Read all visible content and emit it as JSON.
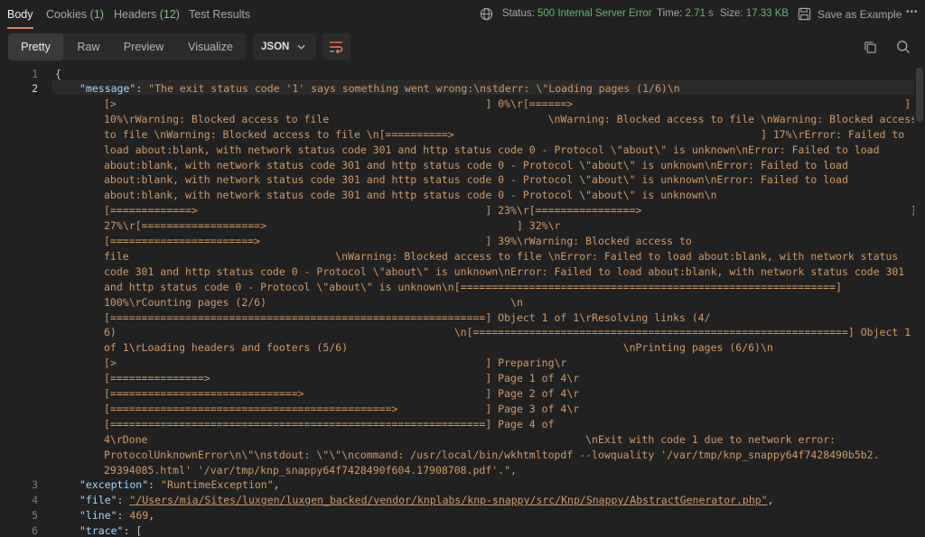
{
  "tabs": {
    "body": "Body",
    "cookies": "Cookies",
    "cookies_count": "(1)",
    "headers": "Headers",
    "headers_count": "(12)",
    "test_results": "Test Results"
  },
  "status": {
    "status_label": "Status:",
    "status_value": "500 Internal Server Error",
    "time_label": "Time:",
    "time_value": "2.71 s",
    "size_label": "Size:",
    "size_value": "17.33 KB",
    "save_label": "Save as Example",
    "more": "•••"
  },
  "toolbar": {
    "pretty": "Pretty",
    "raw": "Raw",
    "preview": "Preview",
    "visualize": "Visualize",
    "format": "JSON"
  },
  "colors": {
    "accent": "#f47c3c",
    "status_ok_text": "#5fb86a",
    "json_key": "#9cdcfe",
    "json_string": "#d19a66"
  },
  "code": {
    "line_numbers": [
      "1",
      "2",
      "3",
      "4",
      "5",
      "6"
    ],
    "l1": "{",
    "l2_key": "\"message\"",
    "l2_colon": ": ",
    "m": [
      "\"The exit status code '1' says something went wrong:\\nstderr: \\\"Loading pages (1/6)\\n",
      "[>                                                           ] 0%\\r[======>                                                     ]",
      "10%\\rWarning: Blocked access to file                                   \\nWarning: Blocked access to file \\nWarning: Blocked access",
      "to file \\nWarning: Blocked access to file \\n[==========>                                                 ] 17%\\rError: Failed to",
      "load about:blank, with network status code 301 and http status code 0 - Protocol \\\"about\\\" is unknown\\nError: Failed to load",
      "about:blank, with network status code 301 and http status code 0 - Protocol \\\"about\\\" is unknown\\nError: Failed to load",
      "about:blank, with network status code 301 and http status code 0 - Protocol \\\"about\\\" is unknown\\nError: Failed to load",
      "about:blank, with network status code 301 and http status code 0 - Protocol \\\"about\\\" is unknown\\n",
      "[=============>                                              ] 23%\\r[================>                                           ]",
      "27%\\r[===================>                                        ] 32%\\r",
      "[=======================>                                    ] 39%\\rWarning: Blocked access to",
      "file                                 \\nWarning: Blocked access to file \\nError: Failed to load about:blank, with network status",
      "code 301 and http status code 0 - Protocol \\\"about\\\" is unknown\\nError: Failed to load about:blank, with network status code 301",
      "and http status code 0 - Protocol \\\"about\\\" is unknown\\n[============================================================]",
      "100%\\rCounting pages (2/6)                                       \\n",
      "[============================================================] Object 1 of 1\\rResolving links (4/",
      "6)                                                      \\n[============================================================] Object 1",
      "of 1\\rLoading headers and footers (5/6)                                            \\nPrinting pages (6/6)\\n",
      "[>                                                           ] Preparing\\r",
      "[===============>                                            ] Page 1 of 4\\r",
      "[==============================>                             ] Page 2 of 4\\r",
      "[=============================================>              ] Page 3 of 4\\r",
      "[============================================================] Page 4 of",
      "4\\rDone                                                                      \\nExit with code 1 due to network error:",
      "ProtocolUnknownError\\n\\\"\\nstdout: \\\"\\\"\\ncommand: /usr/local/bin/wkhtmltopdf --lowquality '/var/tmp/knp_snappy64f7428490b5b2.",
      "29394085.html' '/var/tmp/knp_snappy64f7428490f604.17908708.pdf'.\","
    ],
    "l3_key": "\"exception\"",
    "l3_val": "\"RuntimeException\"",
    "l4_key": "\"file\"",
    "l4_val": "\"/Users/mia/Sites/luxgen/luxgen_backed/vendor/knplabs/knp-snappy/src/Knp/Snappy/AbstractGenerator.php\"",
    "l5_key": "\"line\"",
    "l5_val": "469",
    "l6_key": "\"trace\"",
    "l6_val": "["
  }
}
